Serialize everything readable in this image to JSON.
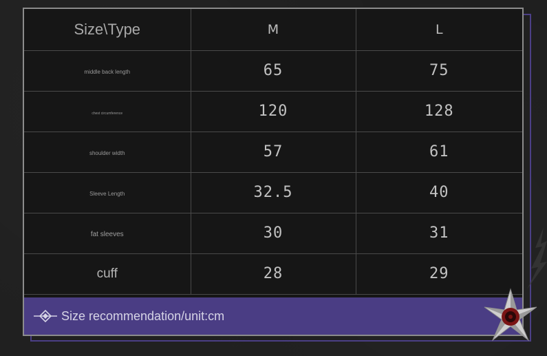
{
  "table": {
    "header": [
      "Size\\Type",
      "M",
      "L"
    ],
    "rows": [
      {
        "label": "middle back length",
        "m": "65",
        "l": "75"
      },
      {
        "label": "chest circumference",
        "m": "120",
        "l": "128"
      },
      {
        "label": "shoulder width",
        "m": "57",
        "l": "61"
      },
      {
        "label": "Sleeve Length",
        "m": "32.5",
        "l": "40"
      },
      {
        "label": "fat sleeves",
        "m": "30",
        "l": "31"
      },
      {
        "label": "cuff",
        "m": "28",
        "l": "29"
      }
    ]
  },
  "footer": {
    "text": "Size recommendation/unit:cm",
    "icon": "diamond-arrow-icon"
  },
  "decoration": {
    "icon": "shuriken-icon"
  },
  "colors": {
    "background": "#1f1f1f",
    "card": "#161616",
    "accent_purple": "#4a3d84",
    "frame_purple": "#4b3f86",
    "shuriken_red": "#7a1414"
  }
}
